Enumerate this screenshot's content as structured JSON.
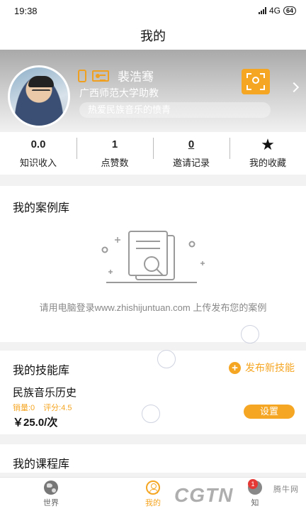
{
  "status_bar": {
    "time": "19:38",
    "network": "4G",
    "battery": "64"
  },
  "nav": {
    "title": "我的"
  },
  "profile": {
    "name": "裴浩骞",
    "title": "广西师范大学助教",
    "motto": "热爱民族音乐的愤青"
  },
  "stats": [
    {
      "value": "0.0",
      "label": "知识收入"
    },
    {
      "value": "1",
      "label": "点赞数"
    },
    {
      "value": "0",
      "label": "邀请记录"
    },
    {
      "value": "",
      "label": "我的收藏"
    }
  ],
  "cases": {
    "title": "我的案例库",
    "empty_hint": "请用电脑登录www.zhishijuntuan.com 上传发布您的案例"
  },
  "skills": {
    "title": "我的技能库",
    "publish_label": "发布新技能",
    "item": {
      "name": "民族音乐历史",
      "sales": "销量:0",
      "rating": "评分:4.5",
      "price": "￥25.0/次",
      "settings_label": "设置"
    }
  },
  "courses": {
    "title": "我的课程库"
  },
  "tabs": [
    {
      "label": "世界",
      "icon": "globe-icon"
    },
    {
      "label": "我的",
      "icon": "person-icon",
      "active": true
    },
    {
      "label": "知",
      "icon": "knowledge-icon",
      "badge": "1"
    }
  ],
  "watermark": {
    "text": "CGTN",
    "site": "腾牛网"
  },
  "colors": {
    "accent": "#f5a623",
    "badge": "#e53935"
  }
}
